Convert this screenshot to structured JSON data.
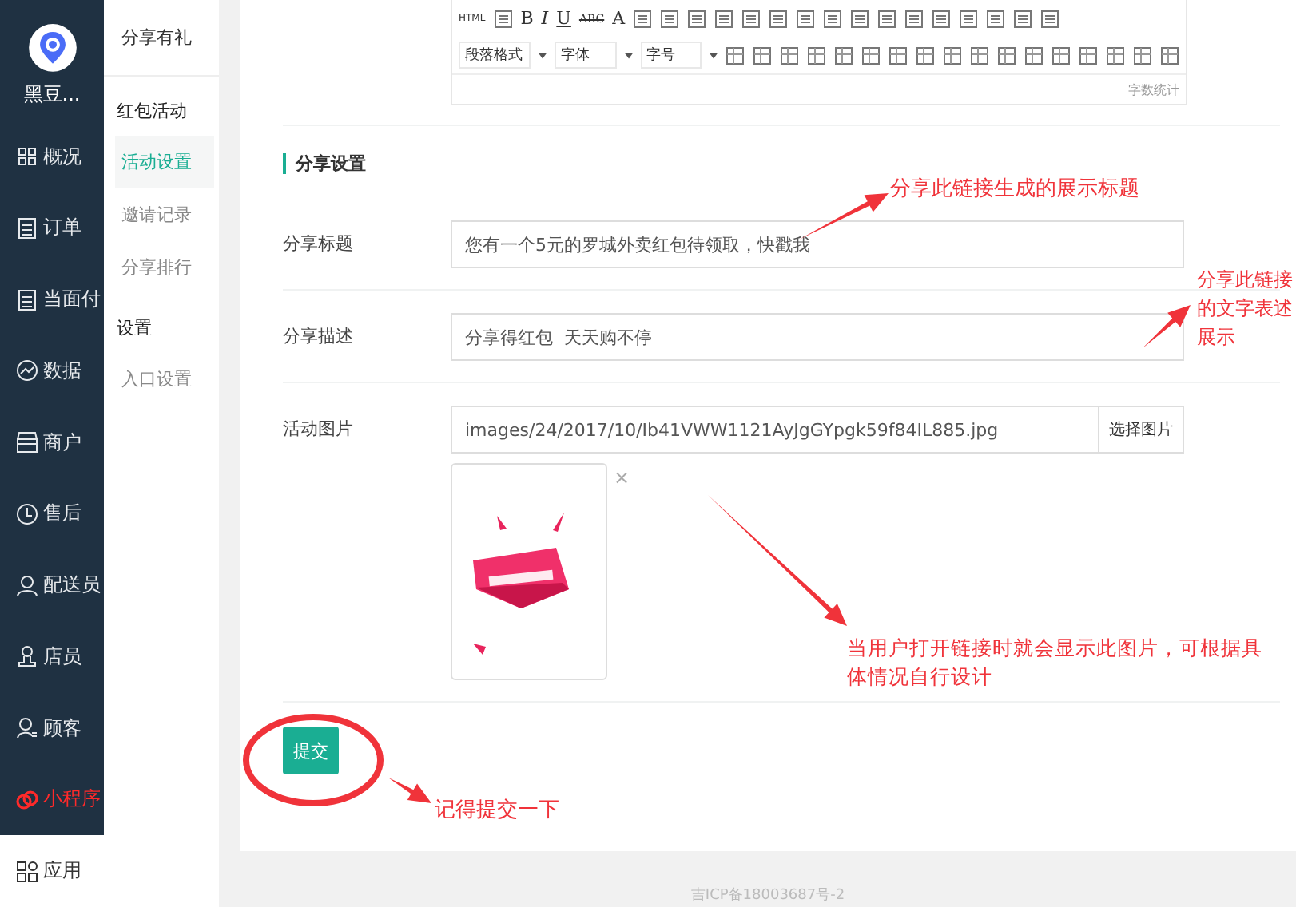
{
  "nav": {
    "brand": "黑豆...",
    "items": [
      {
        "label": "概况",
        "selected": false,
        "highlight": false
      },
      {
        "label": "订单",
        "selected": false,
        "highlight": false
      },
      {
        "label": "当面付",
        "selected": false,
        "highlight": false
      },
      {
        "label": "数据",
        "selected": false,
        "highlight": false
      },
      {
        "label": "商户",
        "selected": false,
        "highlight": false
      },
      {
        "label": "售后",
        "selected": false,
        "highlight": false
      },
      {
        "label": "配送员",
        "selected": false,
        "highlight": false
      },
      {
        "label": "店员",
        "selected": false,
        "highlight": false
      },
      {
        "label": "顾客",
        "selected": false,
        "highlight": false
      },
      {
        "label": "小程序",
        "selected": false,
        "highlight": true
      },
      {
        "label": "应用",
        "selected": true,
        "highlight": false
      }
    ]
  },
  "subnav": {
    "title": "分享有礼",
    "groups": [
      {
        "label": "红包活动",
        "items": [
          {
            "label": "活动设置",
            "selected": true
          },
          {
            "label": "邀请记录",
            "selected": false
          },
          {
            "label": "分享排行",
            "selected": false
          }
        ]
      },
      {
        "label": "设置",
        "items": [
          {
            "label": "入口设置",
            "selected": false
          }
        ]
      }
    ]
  },
  "editor": {
    "row1": [
      "HTML",
      "B",
      "I",
      "U",
      "ABC",
      "A"
    ],
    "selects": [
      "段落格式",
      "字体",
      "字号"
    ],
    "word_count": "字数统计"
  },
  "section_title": "分享设置",
  "fields": [
    {
      "label": "分享标题",
      "value": "您有一个5元的罗城外卖红包待领取，快戳我",
      "kind": "text"
    },
    {
      "label": "分享描述",
      "value": "分享得红包  天天购不停",
      "kind": "text"
    },
    {
      "label": "活动图片",
      "value": "images/24/2017/10/Ib41VWW1121AyJgGYpgk59f84IL885.jpg",
      "kind": "image",
      "button": "选择图片",
      "remove": "×"
    }
  ],
  "submit": "提交",
  "footer": "吉ICP备18003687号-2",
  "annotations": [
    "分享此链接生成的展示标题",
    "分享此链接的文字表述展示",
    "当用户打开链接时就会显示此图片，可根据具体情况自行设计",
    "记得提交一下"
  ]
}
